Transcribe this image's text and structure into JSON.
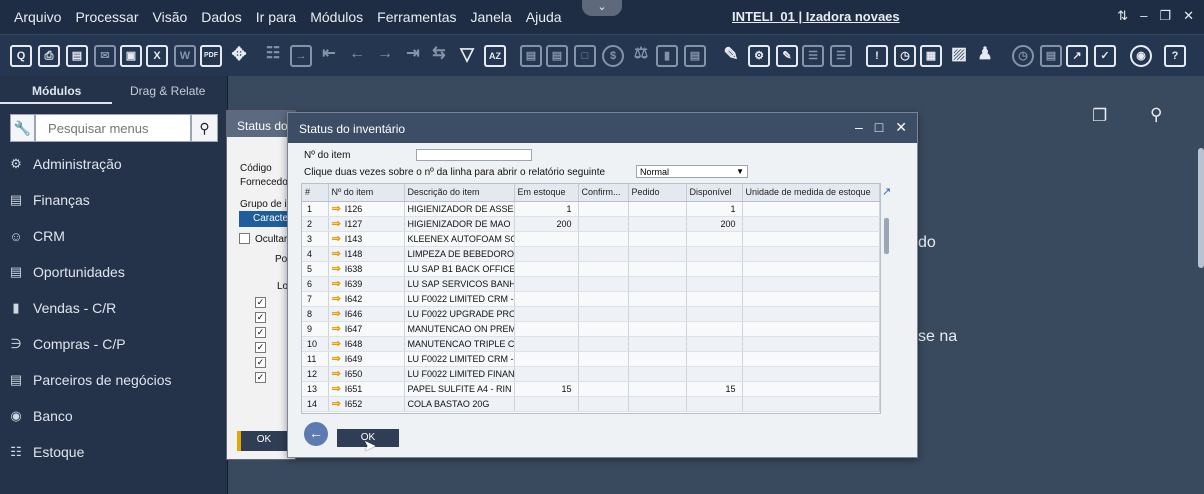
{
  "menubar": {
    "items": [
      "Arquivo",
      "Processar",
      "Visão",
      "Dados",
      "Ir para",
      "Módulos",
      "Ferramentas",
      "Janela",
      "Ajuda"
    ],
    "title": "INTELI_01 | Izadora novaes"
  },
  "sidebar": {
    "tab_modules": "Módulos",
    "tab_drag": "Drag & Relate",
    "search_placeholder": "Pesquisar menus",
    "items": [
      {
        "label": "Administração",
        "icon": "gear-icon"
      },
      {
        "label": "Finanças",
        "icon": "ledger-icon"
      },
      {
        "label": "CRM",
        "icon": "people-icon"
      },
      {
        "label": "Oportunidades",
        "icon": "chart-icon"
      },
      {
        "label": "Vendas - C/R",
        "icon": "sales-doc-icon"
      },
      {
        "label": "Compras - C/P",
        "icon": "cart-icon"
      },
      {
        "label": "Parceiros de negócios",
        "icon": "partners-icon"
      },
      {
        "label": "Banco",
        "icon": "coins-icon"
      },
      {
        "label": "Estoque",
        "icon": "stock-icon"
      }
    ]
  },
  "background": {
    "text_a": "do",
    "text_b": "se na",
    "window_title": "Status do",
    "labels": {
      "codigo": "Código",
      "fornecedor": "Fornecedo",
      "grupo": "Grupo de i",
      "caract": "Caracte",
      "ocultar": "Ocultar",
      "po": "Po",
      "lo": "Lo"
    },
    "ok": "OK"
  },
  "dialog": {
    "title": "Status do inventário",
    "item_label": "Nº do item",
    "hint": "Clique duas vezes sobre o nº da linha para abrir o relatório seguinte",
    "select_value": "Normal",
    "columns": [
      "#",
      "Nº do item",
      "Descrição do item",
      "Em estoque",
      "Confirm...",
      "Pedido",
      "Disponível",
      "Unidade de medida de estoque"
    ],
    "rows": [
      {
        "n": "1",
        "item": "I126",
        "desc": "HIGIENIZADOR DE ASSE",
        "stock": "1",
        "conf": "",
        "order": "",
        "avail": "1",
        "uom": ""
      },
      {
        "n": "2",
        "item": "I127",
        "desc": "HIGIENIZADOR DE MAO",
        "stock": "200",
        "conf": "",
        "order": "",
        "avail": "200",
        "uom": ""
      },
      {
        "n": "3",
        "item": "I143",
        "desc": "KLEENEX AUTOFOAM SO",
        "stock": "",
        "conf": "",
        "order": "",
        "avail": "",
        "uom": ""
      },
      {
        "n": "4",
        "item": "I148",
        "desc": "LIMPEZA DE BEBEDORO",
        "stock": "",
        "conf": "",
        "order": "",
        "avail": "",
        "uom": ""
      },
      {
        "n": "5",
        "item": "I638",
        "desc": "LU SAP B1 BACK OFFICE",
        "stock": "",
        "conf": "",
        "order": "",
        "avail": "",
        "uom": ""
      },
      {
        "n": "6",
        "item": "I639",
        "desc": "LU SAP SERVICOS BANH",
        "stock": "",
        "conf": "",
        "order": "",
        "avail": "",
        "uom": ""
      },
      {
        "n": "7",
        "item": "I642",
        "desc": "LU F0022 LIMITED CRM -",
        "stock": "",
        "conf": "",
        "order": "",
        "avail": "",
        "uom": ""
      },
      {
        "n": "8",
        "item": "I646",
        "desc": "LU F0022 UPGRADE PRO",
        "stock": "",
        "conf": "",
        "order": "",
        "avail": "",
        "uom": ""
      },
      {
        "n": "9",
        "item": "I647",
        "desc": "MANUTENCAO ON PREM",
        "stock": "",
        "conf": "",
        "order": "",
        "avail": "",
        "uom": ""
      },
      {
        "n": "10",
        "item": "I648",
        "desc": "MANUTENCAO TRIPLE C",
        "stock": "",
        "conf": "",
        "order": "",
        "avail": "",
        "uom": ""
      },
      {
        "n": "11",
        "item": "I649",
        "desc": "LU F0022 LIMITED CRM -",
        "stock": "",
        "conf": "",
        "order": "",
        "avail": "",
        "uom": ""
      },
      {
        "n": "12",
        "item": "I650",
        "desc": "LU F0022 LIMITED FINAN",
        "stock": "",
        "conf": "",
        "order": "",
        "avail": "",
        "uom": ""
      },
      {
        "n": "13",
        "item": "I651",
        "desc": "PAPEL SULFITE A4 - RIN",
        "stock": "15",
        "conf": "",
        "order": "",
        "avail": "15",
        "uom": ""
      },
      {
        "n": "14",
        "item": "I652",
        "desc": "COLA BASTAO 20G",
        "stock": "",
        "conf": "",
        "order": "",
        "avail": "",
        "uom": ""
      }
    ],
    "ok": "OK"
  },
  "toolbar": {
    "icons": [
      "preview-icon",
      "print-icon",
      "print-setup-icon",
      "send-icon",
      "export-icon",
      "excel-icon",
      "word-icon",
      "pdf-icon",
      "move-icon",
      "find-icon",
      "add-icon",
      "first-icon",
      "prev-icon",
      "next-icon",
      "last-icon",
      "refresh-icon",
      "filter-icon",
      "sort-icon",
      "base-doc-icon",
      "target-doc-icon",
      "gross-profit-icon",
      "payment-icon",
      "settings-icon",
      "journal-icon",
      "doc-settings-icon",
      "form-settings-icon",
      "edit-icon",
      "user-settings-icon",
      "query-icon",
      "message-icon",
      "alert-icon",
      "calendar-icon",
      "calculator-icon",
      "orgchart-icon",
      "person-icon",
      "portal-icon",
      "home-icon",
      "export-data-icon",
      "report-icon",
      "web-icon",
      "help-icon"
    ]
  }
}
